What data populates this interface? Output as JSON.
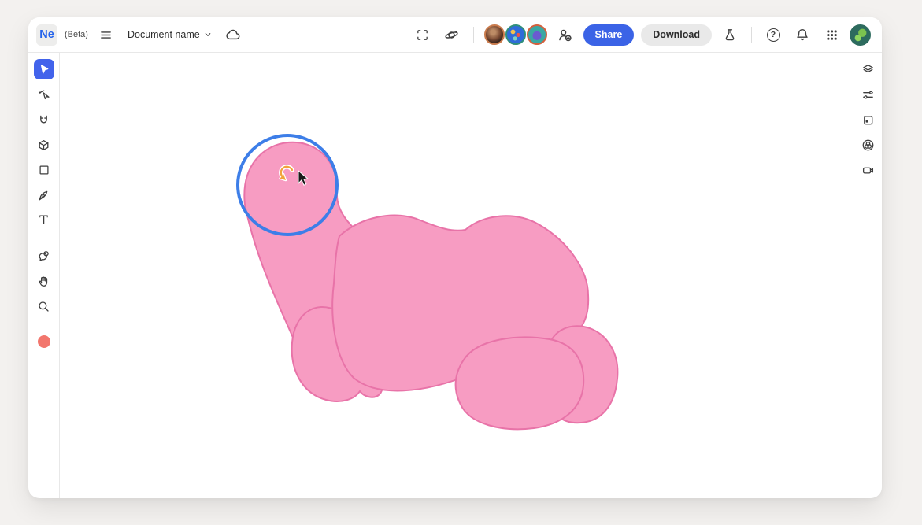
{
  "app": {
    "logo_text": "Ne",
    "beta_label": "(Beta)",
    "document_name": "Document name"
  },
  "header": {
    "share_label": "Share",
    "download_label": "Download",
    "help_glyph": "?",
    "collaborator_count": 3,
    "icons": [
      "hamburger-menu",
      "chevron-down",
      "cloud-sync",
      "fullscreen-frame",
      "orbit-3d",
      "add-collaborator",
      "beaker-experiments",
      "help",
      "notifications",
      "apps-grid",
      "account-avatar"
    ]
  },
  "toolbar_left": {
    "active_tool": "select",
    "text_tool_glyph": "T",
    "icons": [
      "select",
      "direct-select",
      "magnet",
      "cube-3d",
      "rectangle",
      "pen",
      "text",
      "comment",
      "hand",
      "zoom",
      "color-swatch"
    ]
  },
  "panel_right": {
    "icons": [
      "layers",
      "properties-sliders",
      "pages",
      "blend-color",
      "camera"
    ]
  },
  "colors": {
    "accent_blue": "#3B63E6",
    "selection_blue": "#3D7EE8",
    "artwork_fill": "#F79CC2",
    "artwork_stroke": "#E873A8",
    "tool_swatch": "#F2766D",
    "rotate_cursor_orange": "#F2A33C"
  },
  "canvas": {
    "artwork_name": "pink-blob-creature",
    "selected_part": "head-circle"
  }
}
